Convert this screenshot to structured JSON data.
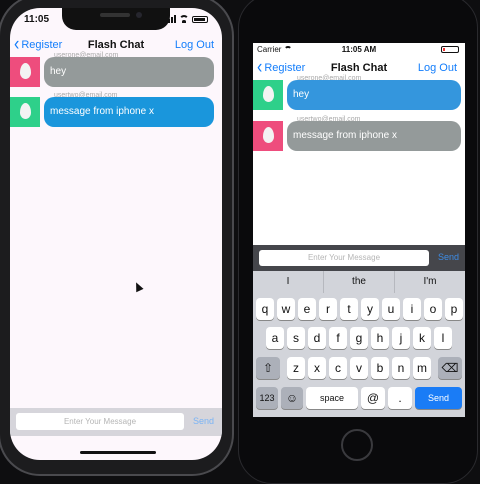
{
  "app": {
    "title": "Flash Chat",
    "back_label": "Register",
    "logout_label": "Log Out"
  },
  "colors": {
    "tint": "#147efb",
    "bubble_gray": "#949a9a",
    "bubble_blue_x": "#1a96dc",
    "bubble_blue_8": "#3496dd",
    "avatar_pink": "#ee4d7d",
    "avatar_green": "#2ed08a"
  },
  "left_phone": {
    "status_time": "11:05",
    "messages": [
      {
        "sender": "userone@email.com",
        "text": "hey",
        "avatar": "egg-avatar-pink",
        "bubble": "gray"
      },
      {
        "sender": "usertwo@email.com",
        "text": "message from iphone x",
        "avatar": "egg-avatar-green",
        "bubble": "blue"
      }
    ],
    "input_placeholder": "Enter Your Message",
    "send_label": "Send"
  },
  "right_phone": {
    "carrier": "Carrier",
    "status_time": "11:05 AM",
    "messages": [
      {
        "sender": "userone@email.com",
        "text": "hey",
        "avatar": "egg-avatar-green",
        "bubble": "blue"
      },
      {
        "sender": "usertwo@email.com",
        "text": "message from iphone x",
        "avatar": "egg-avatar-pink",
        "bubble": "gray"
      }
    ],
    "input_placeholder": "Enter Your Message",
    "send_label": "Send",
    "predictions": [
      "I",
      "the",
      "I'm"
    ],
    "keyboard": {
      "row1": [
        "q",
        "w",
        "e",
        "r",
        "t",
        "y",
        "u",
        "i",
        "o",
        "p"
      ],
      "row2": [
        "a",
        "s",
        "d",
        "f",
        "g",
        "h",
        "j",
        "k",
        "l"
      ],
      "row3": [
        "z",
        "x",
        "c",
        "v",
        "b",
        "n",
        "m"
      ],
      "shift_icon": "shift-icon",
      "delete_icon": "delete-icon",
      "numbers_label": "123",
      "emoji_icon": "emoji-icon",
      "space_label": "space",
      "at_label": "@",
      "dot_label": ".",
      "return_label": "Send"
    }
  }
}
